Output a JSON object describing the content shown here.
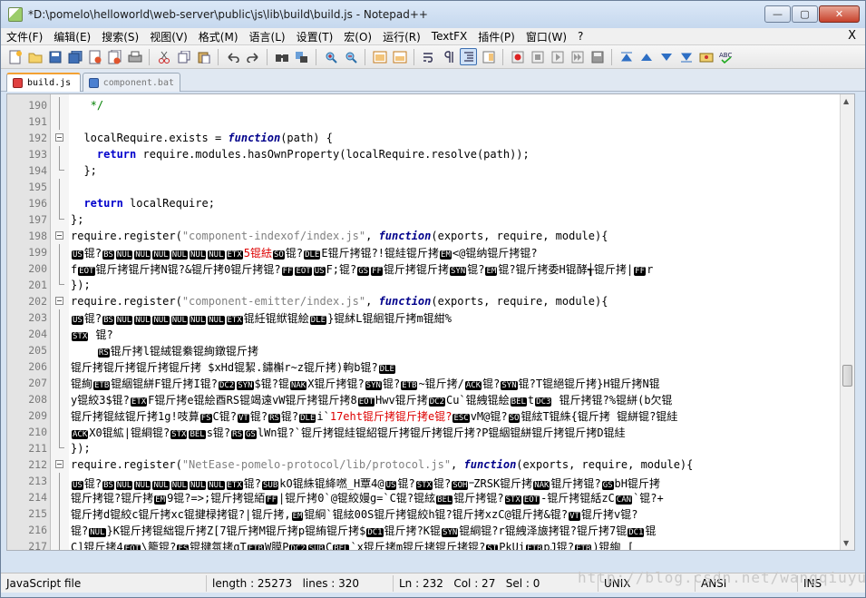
{
  "window": {
    "title": "*D:\\pomelo\\helloworld\\web-server\\public\\js\\lib\\build\\build.js - Notepad++",
    "minimize": "—",
    "maximize": "▢",
    "close": "✕"
  },
  "menu": {
    "items": [
      "文件(F)",
      "编辑(E)",
      "搜索(S)",
      "视图(V)",
      "格式(M)",
      "语言(L)",
      "设置(T)",
      "宏(O)",
      "运行(R)",
      "TextFX",
      "插件(P)",
      "窗口(W)",
      "?"
    ],
    "close": "X"
  },
  "toolbar": {
    "icons": [
      "new-file-icon",
      "open-file-icon",
      "save-icon",
      "save-all-icon",
      "close-icon",
      "close-all-icon",
      "print-icon",
      "cut-icon",
      "copy-icon",
      "paste-icon",
      "undo-icon",
      "redo-icon",
      "find-icon",
      "replace-icon",
      "zoom-in-icon",
      "zoom-out-icon",
      "sync-v-icon",
      "sync-h-icon",
      "wrap-icon",
      "all-chars-icon",
      "indent-guide-icon",
      "doc-map-icon",
      "record-macro-icon",
      "stop-macro-icon",
      "play-macro-icon",
      "run-macro-multiple-icon",
      "save-macro-icon",
      "first-icon",
      "up-icon",
      "down-icon",
      "last-icon",
      "mark-icon",
      "spell-check-icon"
    ]
  },
  "tabs": [
    {
      "label": "build.js",
      "active": true
    },
    {
      "label": "component.bat",
      "active": false
    }
  ],
  "editor": {
    "lines": [
      {
        "n": "190",
        "fold": "vl",
        "html": "  <span class=\"cmt\"> */</span>"
      },
      {
        "n": "191",
        "fold": "vl",
        "html": ""
      },
      {
        "n": "192",
        "fold": "box",
        "html": "  localRequire.exists = <span class=\"kw\">function</span>(path) {"
      },
      {
        "n": "193",
        "fold": "vl",
        "html": "    <span class=\"kw2\">return</span> require.modules.hasOwnProperty(localRequire.resolve(path));"
      },
      {
        "n": "194",
        "fold": "end",
        "html": "  };"
      },
      {
        "n": "195",
        "fold": "vl",
        "html": ""
      },
      {
        "n": "196",
        "fold": "vl",
        "html": "  <span class=\"kw2\">return</span> localRequire;"
      },
      {
        "n": "197",
        "fold": "end",
        "html": "};"
      },
      {
        "n": "198",
        "fold": "box",
        "html": "require.register(<span class=\"str\">\"component-indexof/index.js\"</span>, <span class=\"kw\">function</span>(exports, require, module){"
      },
      {
        "n": "199",
        "fold": "vl",
        "html": "<span class=\"ctrl\">US</span>锟?<span class=\"ctrl\">BS</span><span class=\"ctrl\">NUL</span><span class=\"ctrl\">NUL</span><span class=\"ctrl\">NUL</span><span class=\"ctrl\">NUL</span><span class=\"ctrl\">NUL</span><span class=\"ctrl\">NUL</span><span class=\"ctrl\">ETX</span><span class=\"red\">5锟紶</span><span class=\"ctrl\">SO</span>锟?<span class=\"ctrl\">DLE</span>E锟斤拷锟?!锟絓锟斤拷<span class=\"ctrl\">EM</span><@锟纳锟斤拷锟?"
      },
      {
        "n": "200",
        "fold": "vl",
        "html": "f<span class=\"ctrl\">EOT</span>锟斤拷锟斤拷N锟?&锟斤拷0锟斤拷锟?<span class=\"ctrl\">FF</span><span class=\"ctrl\">EOT</span><span class=\"ctrl\">US</span>F;锟?<span class=\"ctrl\">GS</span><span class=\"ctrl\">FF</span>锟斤拷锟斤拷<span class=\"ctrl\">SYN</span>锟?<span class=\"ctrl\">EM</span>锟?锟斤拷委H锟酵╅锟斤拷|<span class=\"ctrl\">FF</span>r"
      },
      {
        "n": "201",
        "fold": "end",
        "html": "});"
      },
      {
        "n": "202",
        "fold": "box",
        "html": "require.register(<span class=\"str\">\"component-emitter/index.js\"</span>, <span class=\"kw\">function</span>(exports, require, module){"
      },
      {
        "n": "203",
        "fold": "vl",
        "html": "<span class=\"ctrl\">US</span>锟?<span class=\"ctrl\">BS</span><span class=\"ctrl\">NUL</span><span class=\"ctrl\">NUL</span><span class=\"ctrl\">NUL</span><span class=\"ctrl\">NUL</span><span class=\"ctrl\">NUL</span><span class=\"ctrl\">NUL</span><span class=\"ctrl\">ETX</span>锟紝锟絥锟絵<span class=\"ctrl\">DLE</span>}锟絉L锟絗锟斤拷m锟紺%"
      },
      {
        "n": "204",
        "fold": "vl",
        "html": "<span class=\"ctrl\">STX</span> 锟?"
      },
      {
        "n": "205",
        "fold": "vl",
        "html": "    <span class=\"ctrl\">RS</span>锟斤拷l锟絨锟絭锟絢鐓锟斤拷"
      },
      {
        "n": "206",
        "fold": "vl",
        "html": "锟斤拷锟斤拷锟斤拷锟斤拷 $xHd锟絜.鏽槲r~z锟斤拷)軥b锟?<span class=\"ctrl\">DLE</span>"
      },
      {
        "n": "207",
        "fold": "vl",
        "html": "锟絢<span class=\"ctrl\">ETB</span>锟絪锟絣F锟斤拷I锟?<span class=\"ctrl\">DC2</span><span class=\"ctrl\">SYN</span>$锟?锟<span class=\"ctrl\">NAK</span>X锟斤拷锟?<span class=\"ctrl\">SYN</span>锟?<span class=\"ctrl\">ETB</span>~锟斤拷/<span class=\"ctrl\">ACK</span>锟?<span class=\"ctrl\">SYN</span>锟?T锟絕锟斤拷}H锟斤拷N锟"
      },
      {
        "n": "208",
        "fold": "vl",
        "html": "y锟絞3$锟?<span class=\"ctrl\">ETX</span>F锟斤拷e锟絵酉RS锟竭遠vW锟斤拷锟斤拷8<span class=\"ctrl\">EOT</span>Hwv锟斤拷<span class=\"ctrl\">DC2</span>Cu`锟絏锟絵<span class=\"ctrl\">BEL</span>t<span class=\"ctrl\">DC3</span> 锟斤拷锟?%锟絣(b欠锟"
      },
      {
        "n": "209",
        "fold": "vl",
        "html": "锟斤拷锟絃锟斤拷1g!吱萛<span class=\"ctrl\">FS</span>C锟?<span class=\"ctrl\">VT</span>锟?<span class=\"ctrl\">RS</span>锟?<span class=\"ctrl\">DLE</span>i`<span class=\"red\">17eht锟斤拷锟斤拷e锟?</span><span class=\"ctrl\">ESC</span>vM@锟?<span class=\"ctrl\">SO</span>锟絃T锟絑{锟斤拷 锟絣锟?锟絓"
      },
      {
        "n": "210",
        "fold": "vl",
        "html": "<span class=\"ctrl\">ACK</span>X0锟絋|锟絧锟?<span class=\"ctrl\">STX</span><span class=\"ctrl\">BEL</span>s锟?<span class=\"ctrl\">RS</span><span class=\"ctrl\">GS</span>lWn锟?`锟斤拷锟絓锟紹锟斤拷锟斤拷锟斤拷?P锟絪锟絣锟斤拷锟斤拷D锟絓"
      },
      {
        "n": "211",
        "fold": "end",
        "html": "});"
      },
      {
        "n": "212",
        "fold": "box",
        "html": "require.register(<span class=\"str\">\"NetEase-pomelo-protocol/lib/protocol.js\"</span>, <span class=\"kw\">function</span>(exports, require, module){"
      },
      {
        "n": "213",
        "fold": "vl",
        "html": "<span class=\"ctrl\">US</span>锟?<span class=\"ctrl\">BS</span><span class=\"ctrl\">NUL</span><span class=\"ctrl\">NUL</span><span class=\"ctrl\">NUL</span><span class=\"ctrl\">NUL</span><span class=\"ctrl\">NUL</span><span class=\"ctrl\">NUL</span><span class=\"ctrl\">ETX</span>锟?<span class=\"ctrl\">SUB</span>kO锟絑锟絳嘫_H覃4@<span class=\"ctrl\">US</span>锟?<span class=\"ctrl\">STX</span>锟?<span class=\"ctrl\">SOH</span>᠆ZRSK锟斤拷<span class=\"ctrl\">NAK</span>锟斤拷锟?<span class=\"ctrl\">GS</span>bH锟斤拷"
      },
      {
        "n": "214",
        "fold": "vl",
        "html": "锟斤拷锟?锟斤拷<span class=\"ctrl\">EM</span>9锟?=>;锟斤拷锟絔<span class=\"ctrl\">FF</span>|锟斤拷0`@锟絞嫚g=`C锟?锟絃<span class=\"ctrl\">BEL</span>锟斤拷锟?<span class=\"ctrl\">STX</span><span class=\"ctrl\">EOT</span>-锟斤拷锟絬zC<span class=\"ctrl\">CAN</span>`锟?+"
      },
      {
        "n": "215",
        "fold": "vl",
        "html": "锟斤拷d锟絞c锟斤拷xc锟揵椂拷锟?|锟斤拷,<span class=\"ctrl\">EM</span>锟絅`锟絃00S锟斤拷锟絞h锟?锟斤拷xzC@锟斤拷&锟?<span class=\"ctrl\">VT</span>锟斤拷v锟?"
      },
      {
        "n": "216",
        "fold": "vl",
        "html": "锟?<span class=\"ctrl\">NUL</span>}K锟斤拷锟絀锟斤拷Z[7锟斤拷M锟斤拷p锟絠锟斤拷$<span class=\"ctrl\">DC1</span>锟斤拷?K锟<span class=\"ctrl\">SYN</span>锟絧锟?r锟絏泽旇拷锟?锟斤拷7锟<span class=\"ctrl\">DC1</span>锟"
      },
      {
        "n": "217",
        "fold": "vl",
        "html": "C]锟斤拷4<span class=\"ctrl\">EOT</span>\\籠锟?<span class=\"ctrl\">FS</span>锟揵氛拷qT<span class=\"ctrl\">ETB</span>W膜P<span class=\"ctrl\">DC2</span><span class=\"ctrl\">SUB</span>C<span class=\"ctrl\">BEL</span>`x锟斤拷m锟斤拷锟斤拷锟?<span class=\"ctrl\">SI</span>PkUi<span class=\"ctrl\">ETB</span>pJ锟?<span class=\"ctrl\">ETB</span>)锟絢 ["
      }
    ]
  },
  "status": {
    "file_type": "JavaScript file",
    "length": "length : 25273",
    "lines": "lines : 320",
    "ln": "Ln : 232",
    "col": "Col : 27",
    "sel": "Sel : 0",
    "eol": "UNIX",
    "encoding": "ANSI",
    "mode": "INS"
  },
  "watermark": "http://blog.csdn.net/wangqiuyun"
}
